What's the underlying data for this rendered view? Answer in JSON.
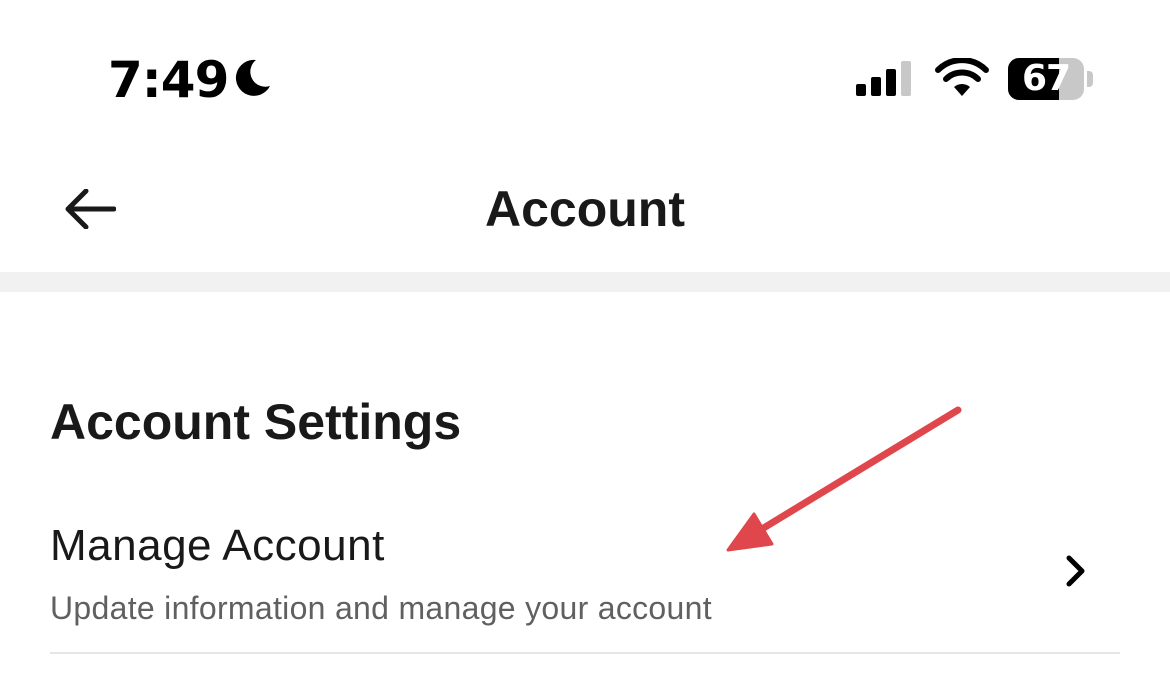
{
  "status_bar": {
    "time": "7:49",
    "focus_icon": "moon-icon",
    "signal_icon": "cellular-signal-icon",
    "wifi_icon": "wifi-icon",
    "battery_level": "67",
    "battery_fraction": 0.67
  },
  "nav": {
    "back_icon": "arrow-left-icon",
    "title": "Account"
  },
  "section": {
    "title": "Account Settings",
    "items": [
      {
        "title": "Manage Account",
        "subtitle": "Update information and manage your account",
        "trailing_icon": "chevron-right-icon"
      }
    ]
  },
  "annotation": {
    "type": "arrow",
    "color": "#e0474c"
  },
  "colors": {
    "background": "#ffffff",
    "text_primary": "#191919",
    "text_secondary": "#606060",
    "divider": "#f1f1f1",
    "annotation_red": "#e0474c"
  }
}
